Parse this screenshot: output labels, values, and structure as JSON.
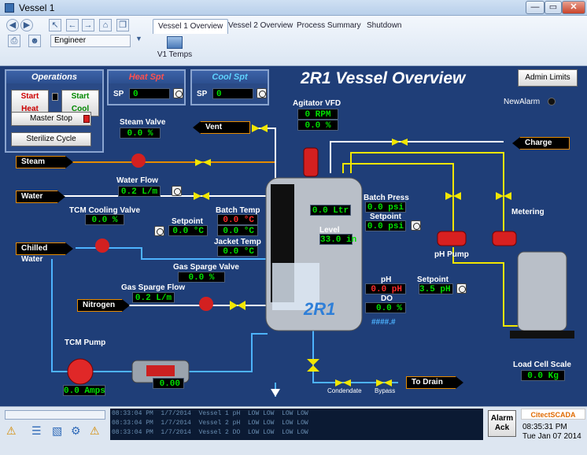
{
  "window": {
    "title": "Vessel 1",
    "min": "—",
    "max": "▭",
    "close": "✕"
  },
  "toolbar": {
    "user": "Engineer",
    "tabs": [
      "Vessel 1 Overview",
      "Vessel 2 Overview",
      "Process Summary",
      "Shutdown"
    ],
    "subpage": "V1 Temps"
  },
  "page_title": "2R1 Vessel Overview",
  "admin_limits": "Admin Limits",
  "new_alarm": "NewAlarm",
  "operations": {
    "title": "Operations",
    "start_heat": "Start Heat",
    "start_cool": "Start Cool",
    "master_stop": "Master Stop",
    "sterilize": "Sterilize Cycle"
  },
  "heat_spt": {
    "title": "Heat Spt",
    "sp_label": "SP",
    "value": "0"
  },
  "cool_spt": {
    "title": "Cool Spt",
    "sp_label": "SP",
    "value": "0"
  },
  "agitator": {
    "label": "Agitator VFD",
    "rpm": "0 RPM",
    "pct": "0.0 %"
  },
  "steam_valve": {
    "label": "Steam Valve",
    "value": "0.0 %"
  },
  "water_flow": {
    "label": "Water Flow",
    "value": "0.2 L/m"
  },
  "tcm_cooling_valve": {
    "label": "TCM Cooling Valve",
    "value": "0.0 %"
  },
  "setpoint_temp": {
    "label": "Setpoint",
    "value": "0.0 °C"
  },
  "batch_temp": {
    "label": "Batch Temp",
    "value": "0.0 °C"
  },
  "batch_temp2": {
    "value": "0.0 °C"
  },
  "jacket_temp": {
    "label": "Jacket Temp",
    "value": "0.0 °C"
  },
  "gas_sparge_valve": {
    "label": "Gas Sparge Valve",
    "value": "0.0 %"
  },
  "gas_sparge_flow": {
    "label": "Gas Sparge Flow",
    "value": "0.2 L/m"
  },
  "tcm_pump": {
    "label": "TCM Pump",
    "value": "0.0 Amps"
  },
  "heater_value": "0.00",
  "tags": {
    "vent": "Vent",
    "steam": "Steam",
    "water": "Water",
    "chilled_water": "Chilled Water",
    "nitrogen": "Nitrogen",
    "charge": "Charge",
    "to_drain": "To Drain"
  },
  "vessel": {
    "name": "2R1",
    "volume": "0.0 Ltr",
    "level_label": "Level",
    "level": "33.0 in"
  },
  "batch_press": {
    "label": "Batch Press",
    "value": "0.0 psi"
  },
  "setpoint_press": {
    "label": "Setpoint",
    "value": "0.0 psi"
  },
  "ph": {
    "label": "pH",
    "value": "0.0 pH",
    "sp_label": "Setpoint",
    "sp_value": "3.5 pH"
  },
  "do": {
    "label": "DO",
    "value": "0.0 %",
    "extra": "####.#"
  },
  "ph_pump": "pH Pump",
  "metering": "Metering",
  "load_cell": {
    "label": "Load Cell Scale",
    "value": "0.0 Kg"
  },
  "condendate": "Condendate",
  "bypass": "Bypass",
  "alarms": [
    {
      "time": "08:33:04 PM",
      "date": "1/7/2014",
      "text": "Vessel 1 pH",
      "state": "LOW LOW",
      "state2": "LOW LOW"
    },
    {
      "time": "08:33:04 PM",
      "date": "1/7/2014",
      "text": "Vessel 2 pH",
      "state": "LOW LOW",
      "state2": "LOW LOW"
    },
    {
      "time": "08:33:04 PM",
      "date": "1/7/2014",
      "text": "Vessel 2 DO",
      "state": "LOW LOW",
      "state2": "LOW LOW"
    }
  ],
  "alarm_ack": "Alarm Ack",
  "brand": "CitectSCADA",
  "clock": {
    "time": "08:35:31 PM",
    "date": "Tue Jan 07 2014"
  },
  "colors": {
    "background": "#1f3e78",
    "value_green": "#00e000",
    "value_red": "#ff2b2b",
    "pipe_yellow": "#f2e600",
    "pipe_orange": "#e58b00"
  }
}
